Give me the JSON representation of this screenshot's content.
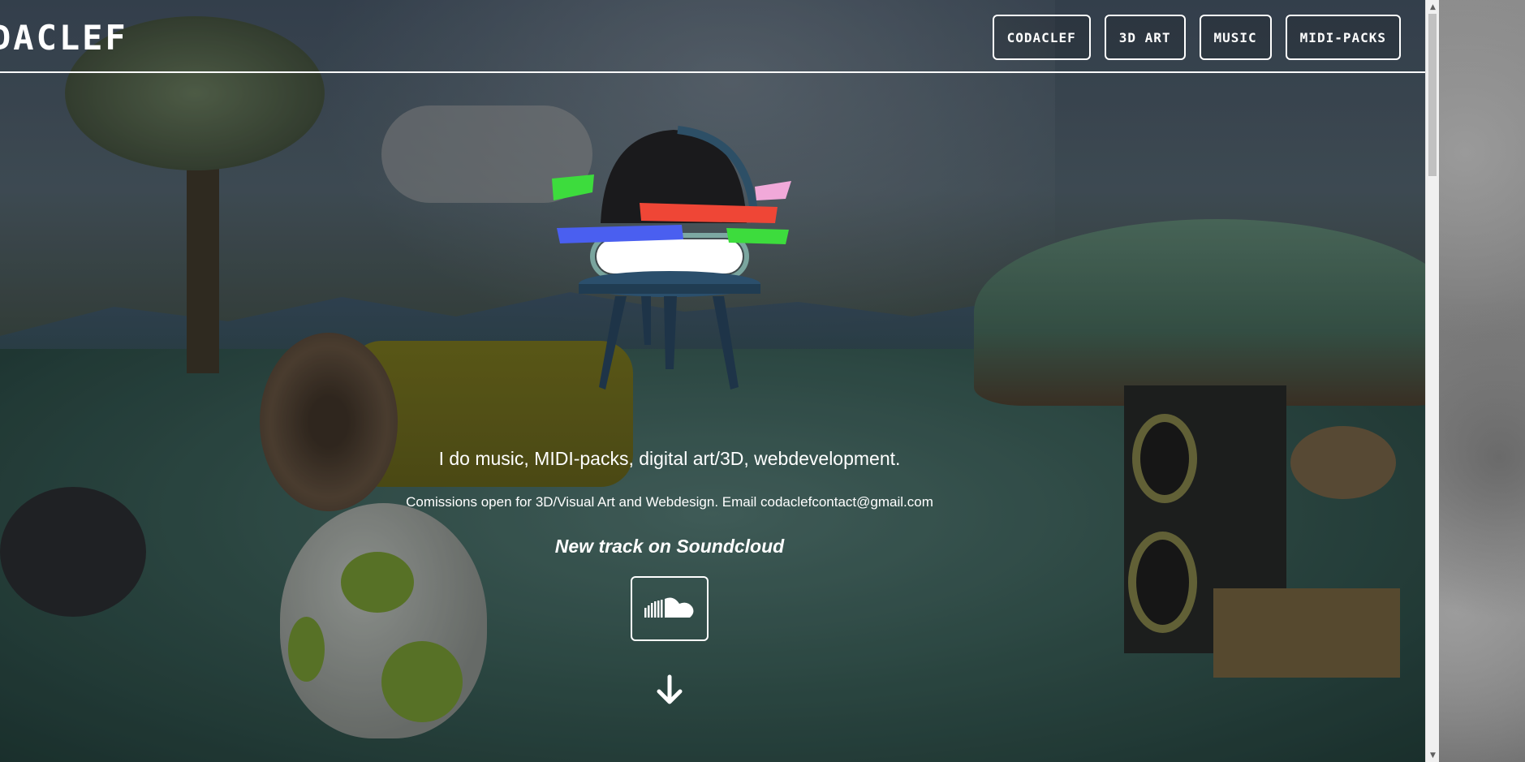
{
  "header": {
    "logo_text": "DACLEF",
    "nav": [
      {
        "label": "CODACLEF"
      },
      {
        "label": "3D ART"
      },
      {
        "label": "MUSIC"
      },
      {
        "label": "MIDI-PACKS"
      }
    ]
  },
  "hero": {
    "tagline": "I do music, MIDI-packs, digital art/3D, webdevelopment.",
    "commission": "Comissions open for 3D/Visual Art and Webdesign. Email codaclefcontact@gmail.com",
    "new_track": "New track on Soundcloud",
    "soundcloud_icon": "soundcloud-icon",
    "scroll_icon": "arrow-down-icon"
  },
  "colors": {
    "text": "#ffffff",
    "stripe_green": "#3ddc3d",
    "stripe_red": "#ef4636",
    "stripe_blue": "#4a5ff0",
    "stripe_pink": "#f1a9d9"
  }
}
